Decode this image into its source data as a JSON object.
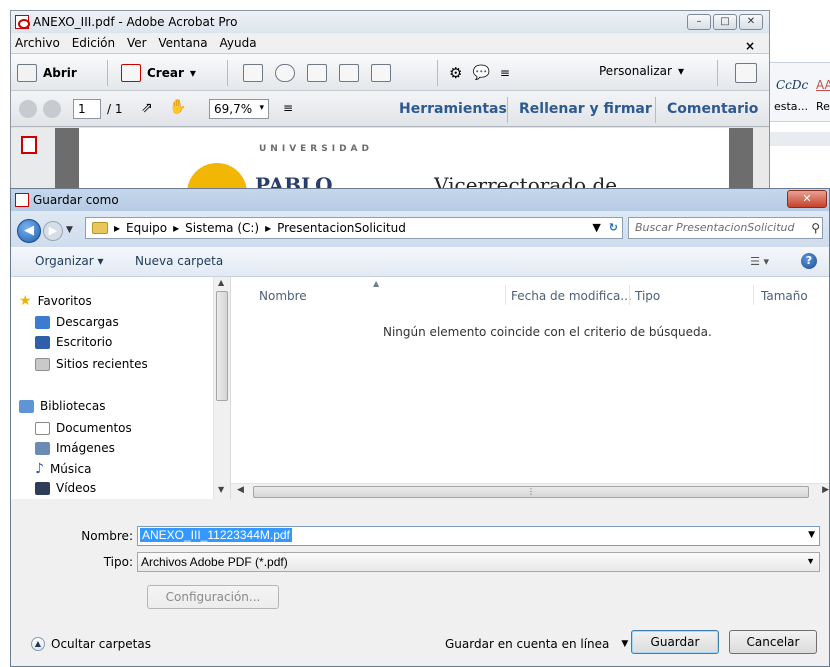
{
  "acrobat": {
    "title": "ANEXO_III.pdf - Adobe Acrobat Pro",
    "menu": [
      "Archivo",
      "Edición",
      "Ver",
      "Ventana",
      "Ayuda"
    ],
    "close_doc": "×",
    "toolbar": {
      "open_label": "Abrir",
      "create_label": "Crear",
      "customize_label": "Personalizar"
    },
    "nav": {
      "page_current": "1",
      "page_total": "/ 1",
      "zoom": "69,7%"
    },
    "panels": {
      "tools": "Herramientas",
      "fill_sign": "Rellenar y firmar",
      "comment": "Comentario"
    },
    "document": {
      "university_text": "UNIVERSIDAD",
      "pablo_text": "PABLO",
      "heading": "Vicerrectorado de Investigación"
    }
  },
  "word": {
    "style1": "CcDc",
    "style2": "AA",
    "label1": "esta...",
    "label2": "Ret"
  },
  "dialog": {
    "title": "Guardar como",
    "breadcrumb": [
      "Equipo",
      "Sistema (C:)",
      "PresentacionSolicitud"
    ],
    "search_placeholder": "Buscar PresentacionSolicitud",
    "organize_label": "Organizar",
    "new_folder_label": "Nueva carpeta",
    "nav_favorites": {
      "header": "Favoritos",
      "items": [
        "Descargas",
        "Escritorio",
        "Sitios recientes"
      ]
    },
    "nav_libraries": {
      "header": "Bibliotecas",
      "items": [
        "Documentos",
        "Imágenes",
        "Música",
        "Vídeos"
      ]
    },
    "columns": [
      "Nombre",
      "Fecha de modifica...",
      "Tipo",
      "Tamaño"
    ],
    "empty_message": "Ningún elemento coincide con el criterio de búsqueda.",
    "name_label": "Nombre:",
    "name_value": "ANEXO_III_11223344M.pdf",
    "type_label": "Tipo:",
    "type_value": "Archivos Adobe PDF (*.pdf)",
    "config_button": "Configuración...",
    "hide_folders": "Ocultar carpetas",
    "save_online": "Guardar en cuenta en línea",
    "save_button": "Guardar",
    "cancel_button": "Cancelar"
  }
}
